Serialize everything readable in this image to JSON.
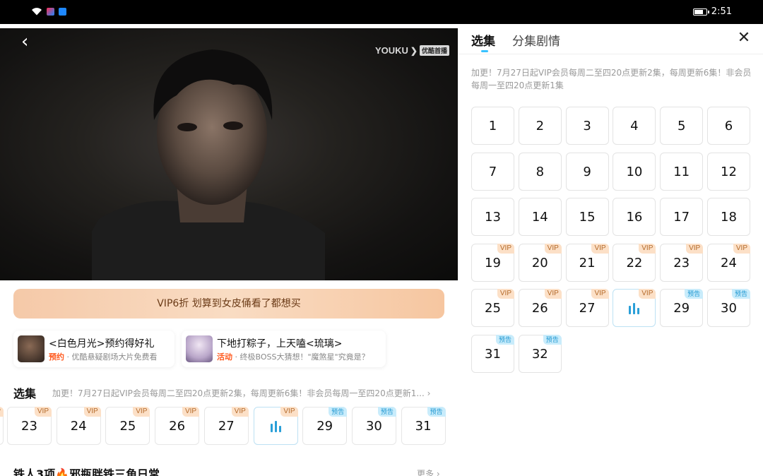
{
  "status_bar": {
    "time": "2:51"
  },
  "video": {
    "watermark_brand": "YOUKU",
    "watermark_badge": "优酷首播"
  },
  "promo_banner": "VIP6折 划算到女皮俑看了都想买",
  "cards": [
    {
      "title": "<白色月光>预约得好礼",
      "tag": "预约",
      "desc": "· 优酷悬疑剧场大片免费看"
    },
    {
      "title": "下地打粽子，上天嗑<琉璃>",
      "tag": "活动",
      "desc": "· 终极BOSS大猜想！\"魔煞星\"究竟是？"
    }
  ],
  "episodes_section": {
    "title": "选集",
    "note": "加更！7月27日起VIP会员每周二至四20点更新2集，每周更新6集！非会员每周一至四20点更新1..."
  },
  "strip_episodes": [
    {
      "num": "23",
      "badge": "VIP"
    },
    {
      "num": "24",
      "badge": "VIP"
    },
    {
      "num": "25",
      "badge": "VIP"
    },
    {
      "num": "26",
      "badge": "VIP"
    },
    {
      "num": "27",
      "badge": "VIP"
    },
    {
      "num": "",
      "badge": "VIP",
      "playing": true
    },
    {
      "num": "29",
      "badge": "预告"
    },
    {
      "num": "30",
      "badge": "预告"
    },
    {
      "num": "31",
      "badge": "预告"
    }
  ],
  "bottom_section": {
    "title": "铁人3项🔥邪瓶胖铁三角日常",
    "more": "更多"
  },
  "drawer": {
    "tabs": [
      "选集",
      "分集剧情"
    ],
    "notice": "加更！7月27日起VIP会员每周二至四20点更新2集，每周更新6集！非会员每周一至四20点更新1集",
    "episodes": [
      {
        "num": "1",
        "badge": ""
      },
      {
        "num": "2",
        "badge": ""
      },
      {
        "num": "3",
        "badge": ""
      },
      {
        "num": "4",
        "badge": ""
      },
      {
        "num": "5",
        "badge": ""
      },
      {
        "num": "6",
        "badge": ""
      },
      {
        "num": "7",
        "badge": ""
      },
      {
        "num": "8",
        "badge": ""
      },
      {
        "num": "9",
        "badge": ""
      },
      {
        "num": "10",
        "badge": ""
      },
      {
        "num": "11",
        "badge": ""
      },
      {
        "num": "12",
        "badge": ""
      },
      {
        "num": "13",
        "badge": ""
      },
      {
        "num": "14",
        "badge": ""
      },
      {
        "num": "15",
        "badge": ""
      },
      {
        "num": "16",
        "badge": ""
      },
      {
        "num": "17",
        "badge": ""
      },
      {
        "num": "18",
        "badge": ""
      },
      {
        "num": "19",
        "badge": "VIP"
      },
      {
        "num": "20",
        "badge": "VIP"
      },
      {
        "num": "21",
        "badge": "VIP"
      },
      {
        "num": "22",
        "badge": "VIP"
      },
      {
        "num": "23",
        "badge": "VIP"
      },
      {
        "num": "24",
        "badge": "VIP"
      },
      {
        "num": "25",
        "badge": "VIP"
      },
      {
        "num": "26",
        "badge": "VIP"
      },
      {
        "num": "27",
        "badge": "VIP"
      },
      {
        "num": "",
        "badge": "VIP",
        "playing": true
      },
      {
        "num": "29",
        "badge": "预告"
      },
      {
        "num": "30",
        "badge": "预告"
      },
      {
        "num": "31",
        "badge": "预告"
      },
      {
        "num": "32",
        "badge": "预告"
      }
    ]
  },
  "colors": {
    "accent": "#39c2ff",
    "vip_badge": "#fce0c7",
    "preview_badge": "#c9ecfb",
    "promo": "#f5c9a8",
    "tag_orange": "#ff5a1f"
  }
}
